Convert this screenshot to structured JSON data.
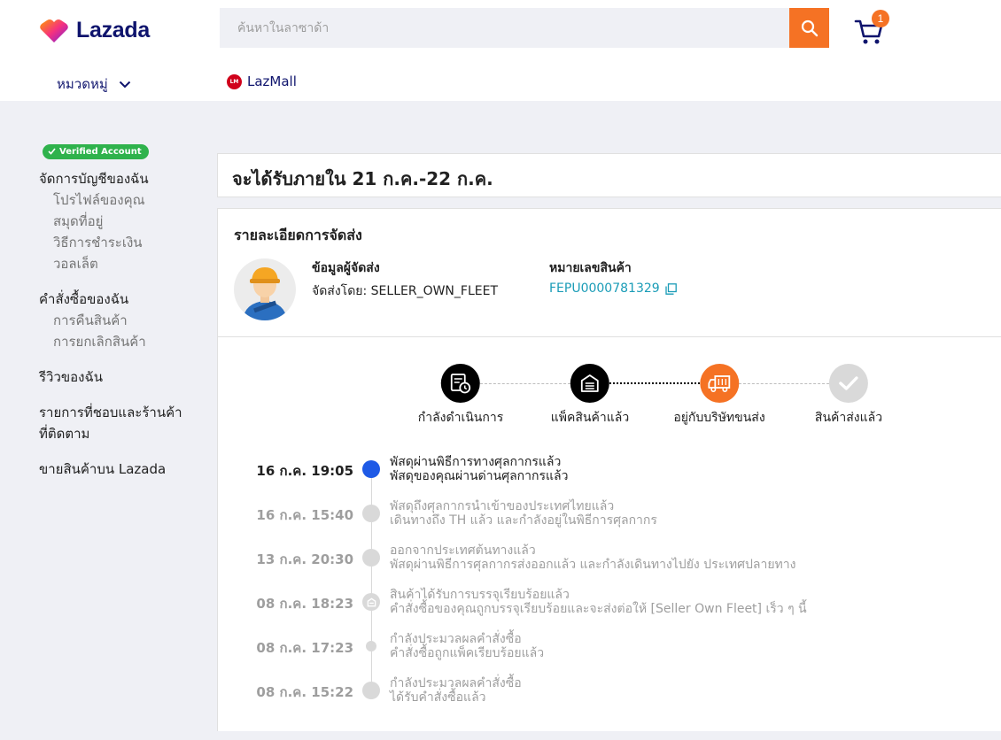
{
  "header": {
    "logo_text": "Lazada",
    "search_placeholder": "ค้นหาในลาซาด้า",
    "cart_count": "1",
    "category_label": "หมวดหมู่",
    "lazmall_label": "LazMall",
    "lazmall_icon_text": "LM"
  },
  "sidebar": {
    "verified_label": "Verified Account",
    "account_head": "จัดการบัญชีของฉัน",
    "account_items": [
      "โปรไฟล์ของคุณ",
      "สมุดที่อยู่",
      "วิธีการชำระเงิน",
      "วอลเล็ต"
    ],
    "orders_head": "คำสั่งซื้อของฉัน",
    "orders_items": [
      "การคืนสินค้า",
      "การยกเลิกสินค้า"
    ],
    "reviews_head": "รีวิวของฉัน",
    "wishlist_head_1": "รายการที่ชอบและร้านค้า",
    "wishlist_head_2": "ที่ติดตาม",
    "sell_head": "ขายสินค้าบน Lazada"
  },
  "eta": {
    "text": "จะได้รับภายใน 21 ก.ค.-22 ก.ค."
  },
  "shipping": {
    "title": "รายละเอียดการจัดส่ง",
    "carrier_label": "ข้อมูลผู้จัดส่ง",
    "carrier_value": "จัดส่งโดย: SELLER_OWN_FLEET",
    "tracking_label": "หมายเลขสินค้า",
    "tracking_value": "FEPU0000781329"
  },
  "steps": [
    {
      "label": "กำลังดำเนินการ",
      "state": "done",
      "icon": "order-receipt-icon"
    },
    {
      "label": "แพ็คสินค้าแล้ว",
      "state": "done",
      "icon": "warehouse-icon"
    },
    {
      "label": "อยู่กับบริษัทขนส่ง",
      "state": "current",
      "icon": "truck-icon"
    },
    {
      "label": "สินค้าส่งแล้ว",
      "state": "pending",
      "icon": "check-icon"
    }
  ],
  "events": [
    {
      "time": "16 ก.ค. 19:05",
      "title": "พัสดุผ่านพิธีการทางศุลกากรแล้ว",
      "desc": "พัสดุของคุณผ่านด่านศุลกากรแล้ว"
    },
    {
      "time": "16 ก.ค. 15:40",
      "title": "พัสดุถึงศุลกากรนำเข้าของประเทศไทยแล้ว",
      "desc": "เดินทางถึง TH แล้ว และกำลังอยู่ในพิธีการศุลกากร"
    },
    {
      "time": "13 ก.ค. 20:30",
      "title": "ออกจากประเทศต้นทางแล้ว",
      "desc": "พัสดุผ่านพิธีการศุลกากรส่งออกแล้ว และกำลังเดินทางไปยัง ประเทศปลายทาง"
    },
    {
      "time": "08 ก.ค. 18:23",
      "title": "สินค้าได้รับการบรรจุเรียบร้อยแล้ว",
      "desc": "คำสั่งซื้อของคุณถูกบรรจุเรียบร้อยและจะส่งต่อให้ [Seller Own Fleet] เร็ว ๆ นี้"
    },
    {
      "time": "08 ก.ค. 17:23",
      "title": "กำลังประมวลผลคำสั่งซื้อ",
      "desc": "คำสั่งซื้อถูกแพ็คเรียบร้อยแล้ว"
    },
    {
      "time": "08 ก.ค. 15:22",
      "title": "กำลังประมวลผลคำสั่งซื้อ",
      "desc": "ได้รับคำสั่งซื้อแล้ว"
    }
  ],
  "colors": {
    "brand_orange": "#f57224",
    "brand_navy": "#0f146d",
    "link_teal": "#1a9cb7",
    "current_blue": "#1e5ae6",
    "verified_green": "#2fb24c"
  }
}
